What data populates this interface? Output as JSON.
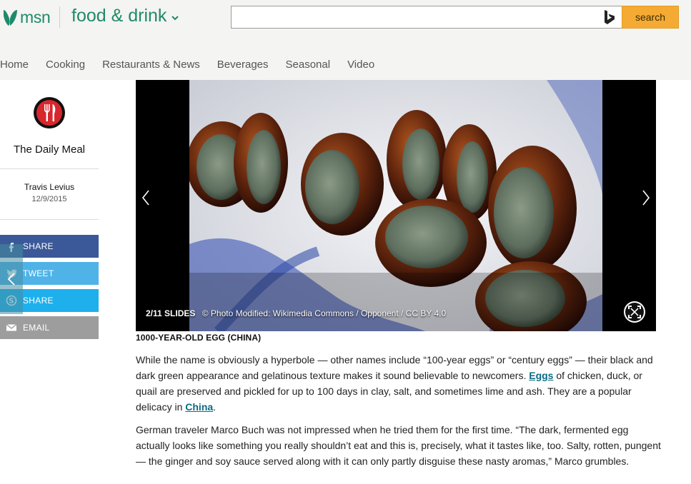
{
  "header": {
    "logo_text": "msn",
    "section_title": "food & drink",
    "search": {
      "placeholder": "",
      "value": "",
      "button_label": "search"
    },
    "nav": [
      "Home",
      "Cooking",
      "Restaurants & News",
      "Beverages",
      "Seasonal",
      "Video"
    ]
  },
  "rail": {
    "brand_name": "The Daily Meal",
    "author": "Travis Levius",
    "date": "12/9/2015",
    "share_buttons": [
      {
        "label": "SHARE",
        "icon": "facebook-icon",
        "color": "#3b5998"
      },
      {
        "label": "TWEET",
        "icon": "twitter-icon",
        "color": "#4fb3e8"
      },
      {
        "label": "SHARE",
        "icon": "skype-icon",
        "color": "#1eb0ec"
      },
      {
        "label": "EMAIL",
        "icon": "email-icon",
        "color": "#9d9d9d"
      }
    ]
  },
  "slideshow": {
    "counter": "2/11 SLIDES",
    "credit": "© Photo Modified: Wikimedia Commons / Opponent / CC BY 4.0"
  },
  "article": {
    "slide_title": "1000-YEAR-OLD EGG (CHINA)",
    "p1_before": "While the name is obviously a hyperbole — other names include “100-year eggs” or “century eggs” — their black and dark green appearance and gelatinous texture makes it sound believable to newcomers. ",
    "p1_link1": "Eggs",
    "p1_middle": " of chicken, duck, or quail are preserved and pickled for up to 100 days in clay, salt, and sometimes lime and ash. They are a popular delicacy in ",
    "p1_link2": "China",
    "p1_after": ".",
    "p2": "German traveler Marco Buch was not impressed when he tried them for the first time. “The dark, fermented egg actually looks like something you really shouldn’t eat and this is, precisely, what it tastes like, too. Salty, rotten, pungent — the ginger and soy sauce served along with it can only partly disguise these nasty aromas,” Marco grumbles."
  },
  "colors": {
    "brand_green": "#1f8a6b",
    "search_orange": "#f5ab33",
    "link": "#0b6b85"
  }
}
